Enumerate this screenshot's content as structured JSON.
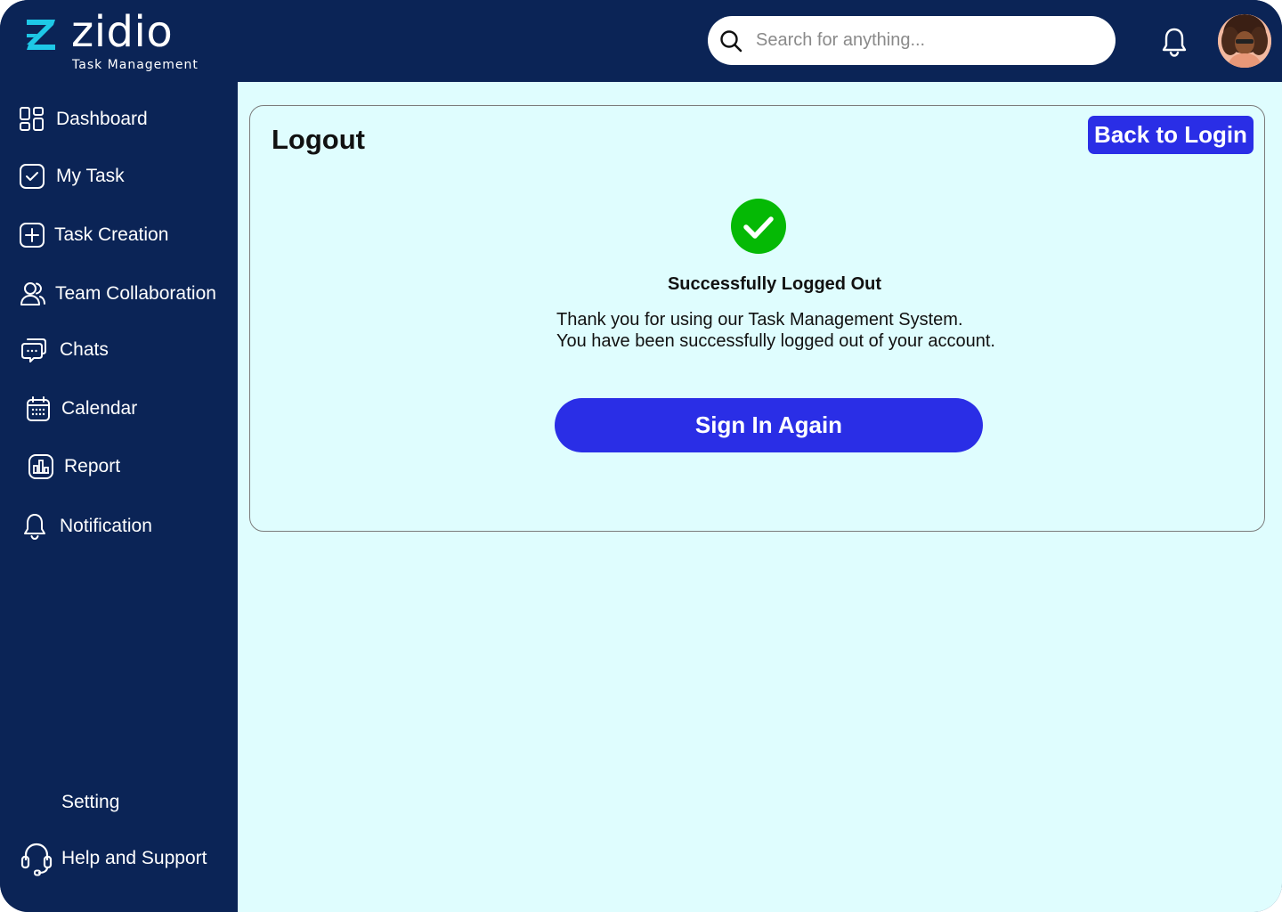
{
  "brand": {
    "name": "zidio",
    "tagline": "Task Management",
    "accent_color": "#1ec8e6",
    "nav_bg": "#0b2456"
  },
  "header": {
    "search_placeholder": "Search for anything...",
    "icons": [
      "search-icon",
      "bell-icon"
    ],
    "avatar": "user-avatar"
  },
  "sidebar": {
    "items": [
      {
        "label": "Dashboard",
        "icon": "dashboard-grid-icon"
      },
      {
        "label": "My Task",
        "icon": "checkbox-icon"
      },
      {
        "label": "Task Creation",
        "icon": "plus-square-icon"
      },
      {
        "label": "Team Collaboration",
        "icon": "users-icon"
      },
      {
        "label": "Chats",
        "icon": "chat-icon"
      },
      {
        "label": "Calendar",
        "icon": "calendar-icon"
      },
      {
        "label": "Report",
        "icon": "report-chart-icon"
      },
      {
        "label": "Notification",
        "icon": "bell-icon"
      }
    ],
    "bottom_items": [
      {
        "label": "Setting",
        "icon": ""
      },
      {
        "label": "Help and Support",
        "icon": "headset-icon"
      }
    ]
  },
  "main": {
    "title": "Logout",
    "back_button": "Back to Login",
    "success_title": "Successfully Logged Out",
    "message_line1": "Thank you for using our Task Management System.",
    "message_line2": "You have been successfully logged out of your account.",
    "signin_button": "Sign In Again",
    "button_color": "#2a2ee6",
    "success_color": "#05b905",
    "background": "#dffdfe"
  }
}
